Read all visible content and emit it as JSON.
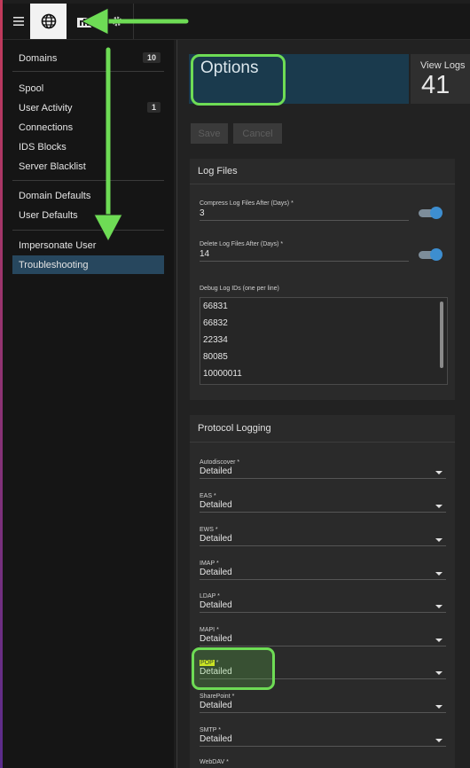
{
  "toolbar": {
    "menu_icon": "hamburger-icon",
    "globe_icon": "globe-icon",
    "chart_icon": "bar-chart-icon",
    "gear_icon": "gear-icon"
  },
  "sidebar": {
    "items": [
      {
        "label": "Domains",
        "badge": "10"
      },
      {
        "label": "Spool",
        "badge": ""
      },
      {
        "label": "User Activity",
        "badge": "1"
      },
      {
        "label": "Connections",
        "badge": ""
      },
      {
        "label": "IDS Blocks",
        "badge": ""
      },
      {
        "label": "Server Blacklist",
        "badge": ""
      },
      {
        "label": "Domain Defaults",
        "badge": ""
      },
      {
        "label": "User Defaults",
        "badge": ""
      },
      {
        "label": "Impersonate User",
        "badge": ""
      },
      {
        "label": "Troubleshooting",
        "badge": "",
        "active": true
      }
    ]
  },
  "main": {
    "options_tile": {
      "title": "Options"
    },
    "logs_tile": {
      "label": "View Logs",
      "count": "41"
    },
    "save_label": "Save",
    "cancel_label": "Cancel",
    "log_files": {
      "title": "Log Files",
      "compress": {
        "label": "Compress Log Files After (Days) *",
        "value": "3",
        "enabled": true
      },
      "delete": {
        "label": "Delete Log Files After (Days) *",
        "value": "14",
        "enabled": true
      },
      "debug_ids": {
        "label": "Debug Log IDs (one per line)",
        "lines": [
          "66831",
          "66832",
          "22334",
          "80085",
          "10000011"
        ]
      }
    },
    "protocol_logging": {
      "title": "Protocol Logging",
      "fields": [
        {
          "label": "Autodiscover",
          "value": "Detailed"
        },
        {
          "label": "EAS",
          "value": "Detailed"
        },
        {
          "label": "EWS",
          "value": "Detailed"
        },
        {
          "label": "IMAP",
          "value": "Detailed"
        },
        {
          "label": "LDAP",
          "value": "Detailed"
        },
        {
          "label": "MAPI",
          "value": "Detailed"
        },
        {
          "label": "POP",
          "value": "Detailed",
          "highlighted": true
        },
        {
          "label": "SharePoint",
          "value": "Detailed"
        },
        {
          "label": "SMTP",
          "value": "Detailed"
        },
        {
          "label": "WebDAV",
          "value": ""
        }
      ],
      "required_mark": "*"
    }
  },
  "colors": {
    "accent": "#3d8ed0",
    "active_nav": "#27475e",
    "annotation_green": "#6edc55",
    "highlight_yellow": "#e5e617"
  }
}
